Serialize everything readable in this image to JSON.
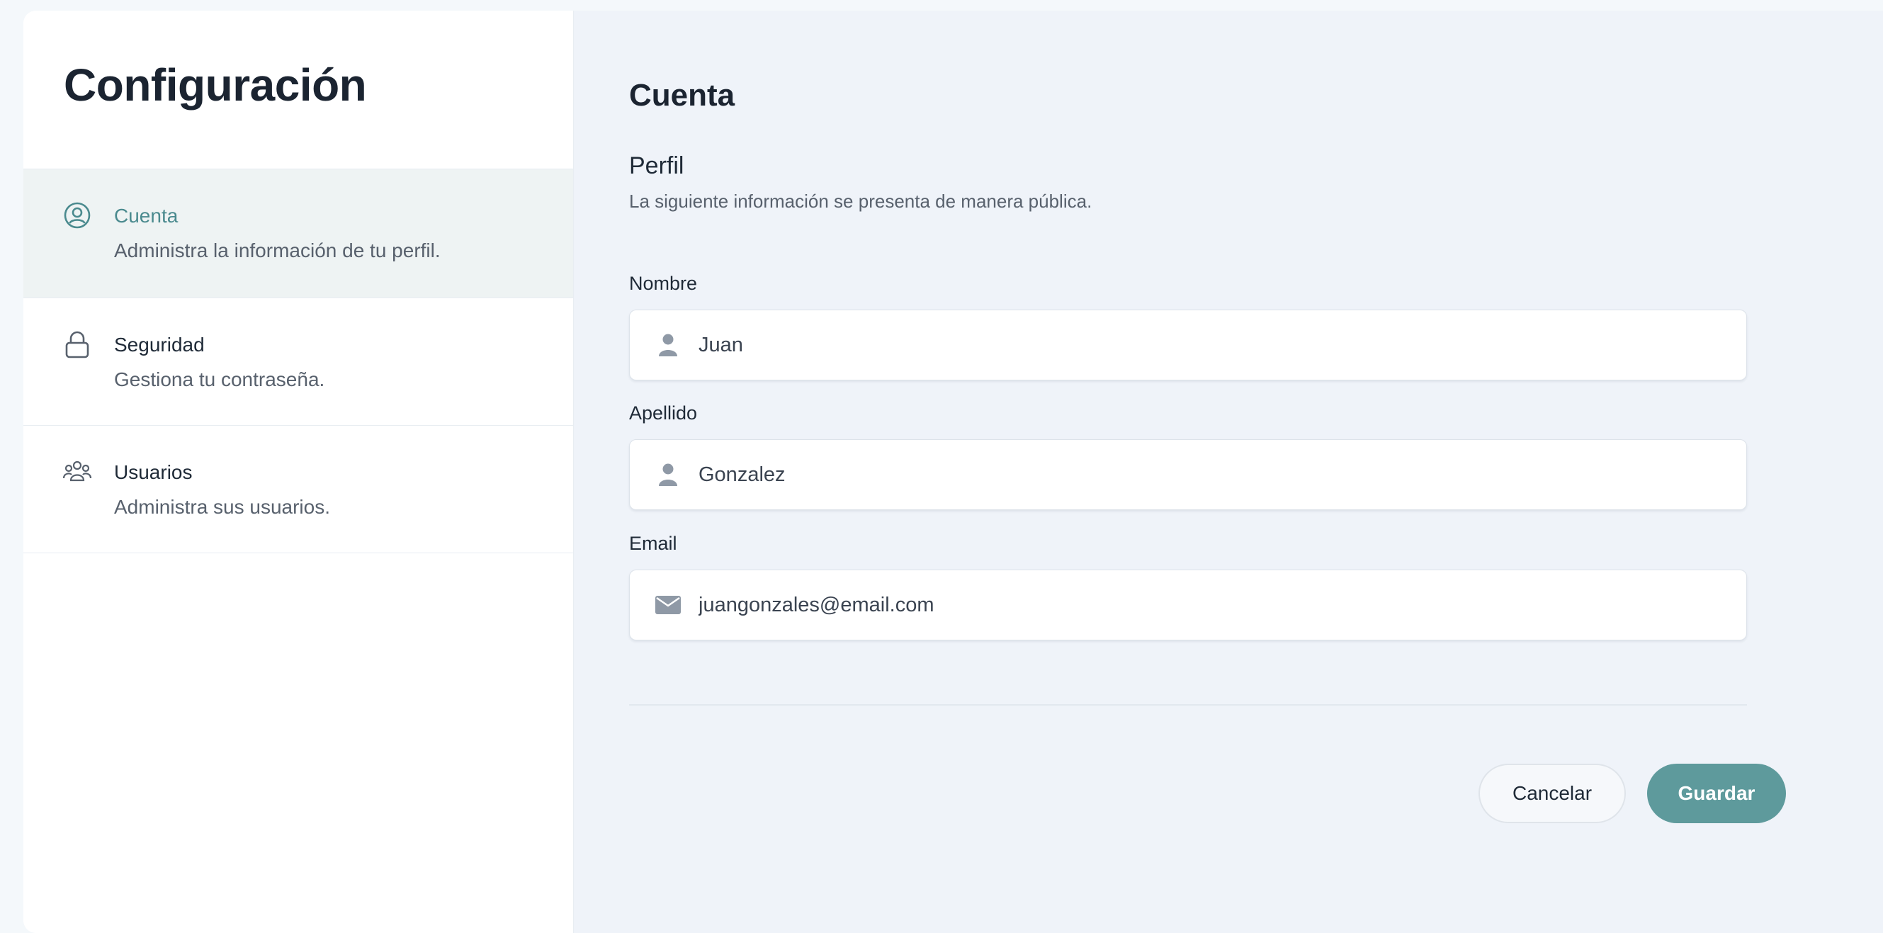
{
  "sidebar": {
    "title": "Configuración",
    "items": [
      {
        "label": "Cuenta",
        "description": "Administra la información de tu perfil.",
        "icon": "user-circle-icon",
        "active": true
      },
      {
        "label": "Seguridad",
        "description": "Gestiona tu contraseña.",
        "icon": "lock-icon",
        "active": false
      },
      {
        "label": "Usuarios",
        "description": "Administra sus usuarios.",
        "icon": "users-icon",
        "active": false
      }
    ]
  },
  "main": {
    "title": "Cuenta",
    "section_title": "Perfil",
    "section_description": "La siguiente información se presenta de manera pública.",
    "fields": {
      "first_name": {
        "label": "Nombre",
        "value": "Juan",
        "icon": "person-icon"
      },
      "last_name": {
        "label": "Apellido",
        "value": "Gonzalez",
        "icon": "person-icon"
      },
      "email": {
        "label": "Email",
        "value": "juangonzales@email.com",
        "icon": "envelope-icon"
      }
    },
    "buttons": {
      "cancel_label": "Cancelar",
      "save_label": "Guardar"
    }
  },
  "colors": {
    "accent": "#5e9a9c",
    "active_text": "#4a8a8e",
    "active_background": "#eef3f3",
    "main_background": "#eff3f9"
  }
}
